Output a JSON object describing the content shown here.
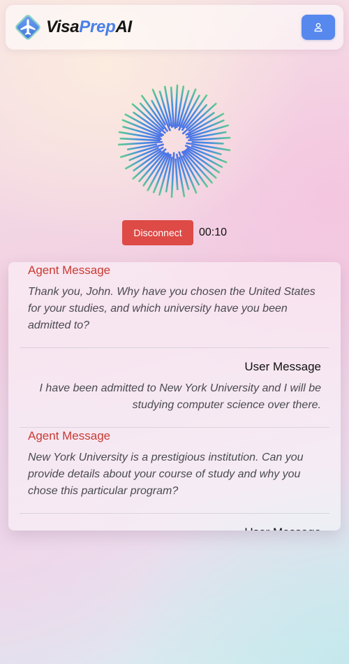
{
  "header": {
    "brand": {
      "part1": "Visa",
      "part2": "Prep",
      "part3": "AI"
    },
    "logo_icon": "airplane-diamond-logo",
    "user_button_icon": "user-icon",
    "colors": {
      "brand_accent": "#4a7fe6",
      "button_bg": "#5688ee"
    }
  },
  "visualizer": {
    "icon": "circular-audio-waveform",
    "colors": {
      "outer": "#5fcf8a",
      "inner": "#4a74e6"
    }
  },
  "controls": {
    "disconnect_label": "Disconnect",
    "timer": "00:10",
    "colors": {
      "disconnect_bg": "#de4a46"
    }
  },
  "transcript": {
    "messages": [
      {
        "role": "Agent Message",
        "type": "agent",
        "text": "Thank you, John. Why have you chosen the United States for your studies, and which university have you been admitted to?"
      },
      {
        "role": "User Message",
        "type": "user",
        "text": "I have been admitted to New York University and I will be studying computer science over there."
      },
      {
        "role": "Agent Message",
        "type": "agent",
        "text": "New York University is a prestigious institution. Can you provide details about your course of study and why you chose this particular program?"
      },
      {
        "role": "User Message",
        "type": "user",
        "text": ""
      }
    ],
    "colors": {
      "agent_role": "#c93a32",
      "user_role": "#111111",
      "body_text": "#4a4a52"
    }
  }
}
